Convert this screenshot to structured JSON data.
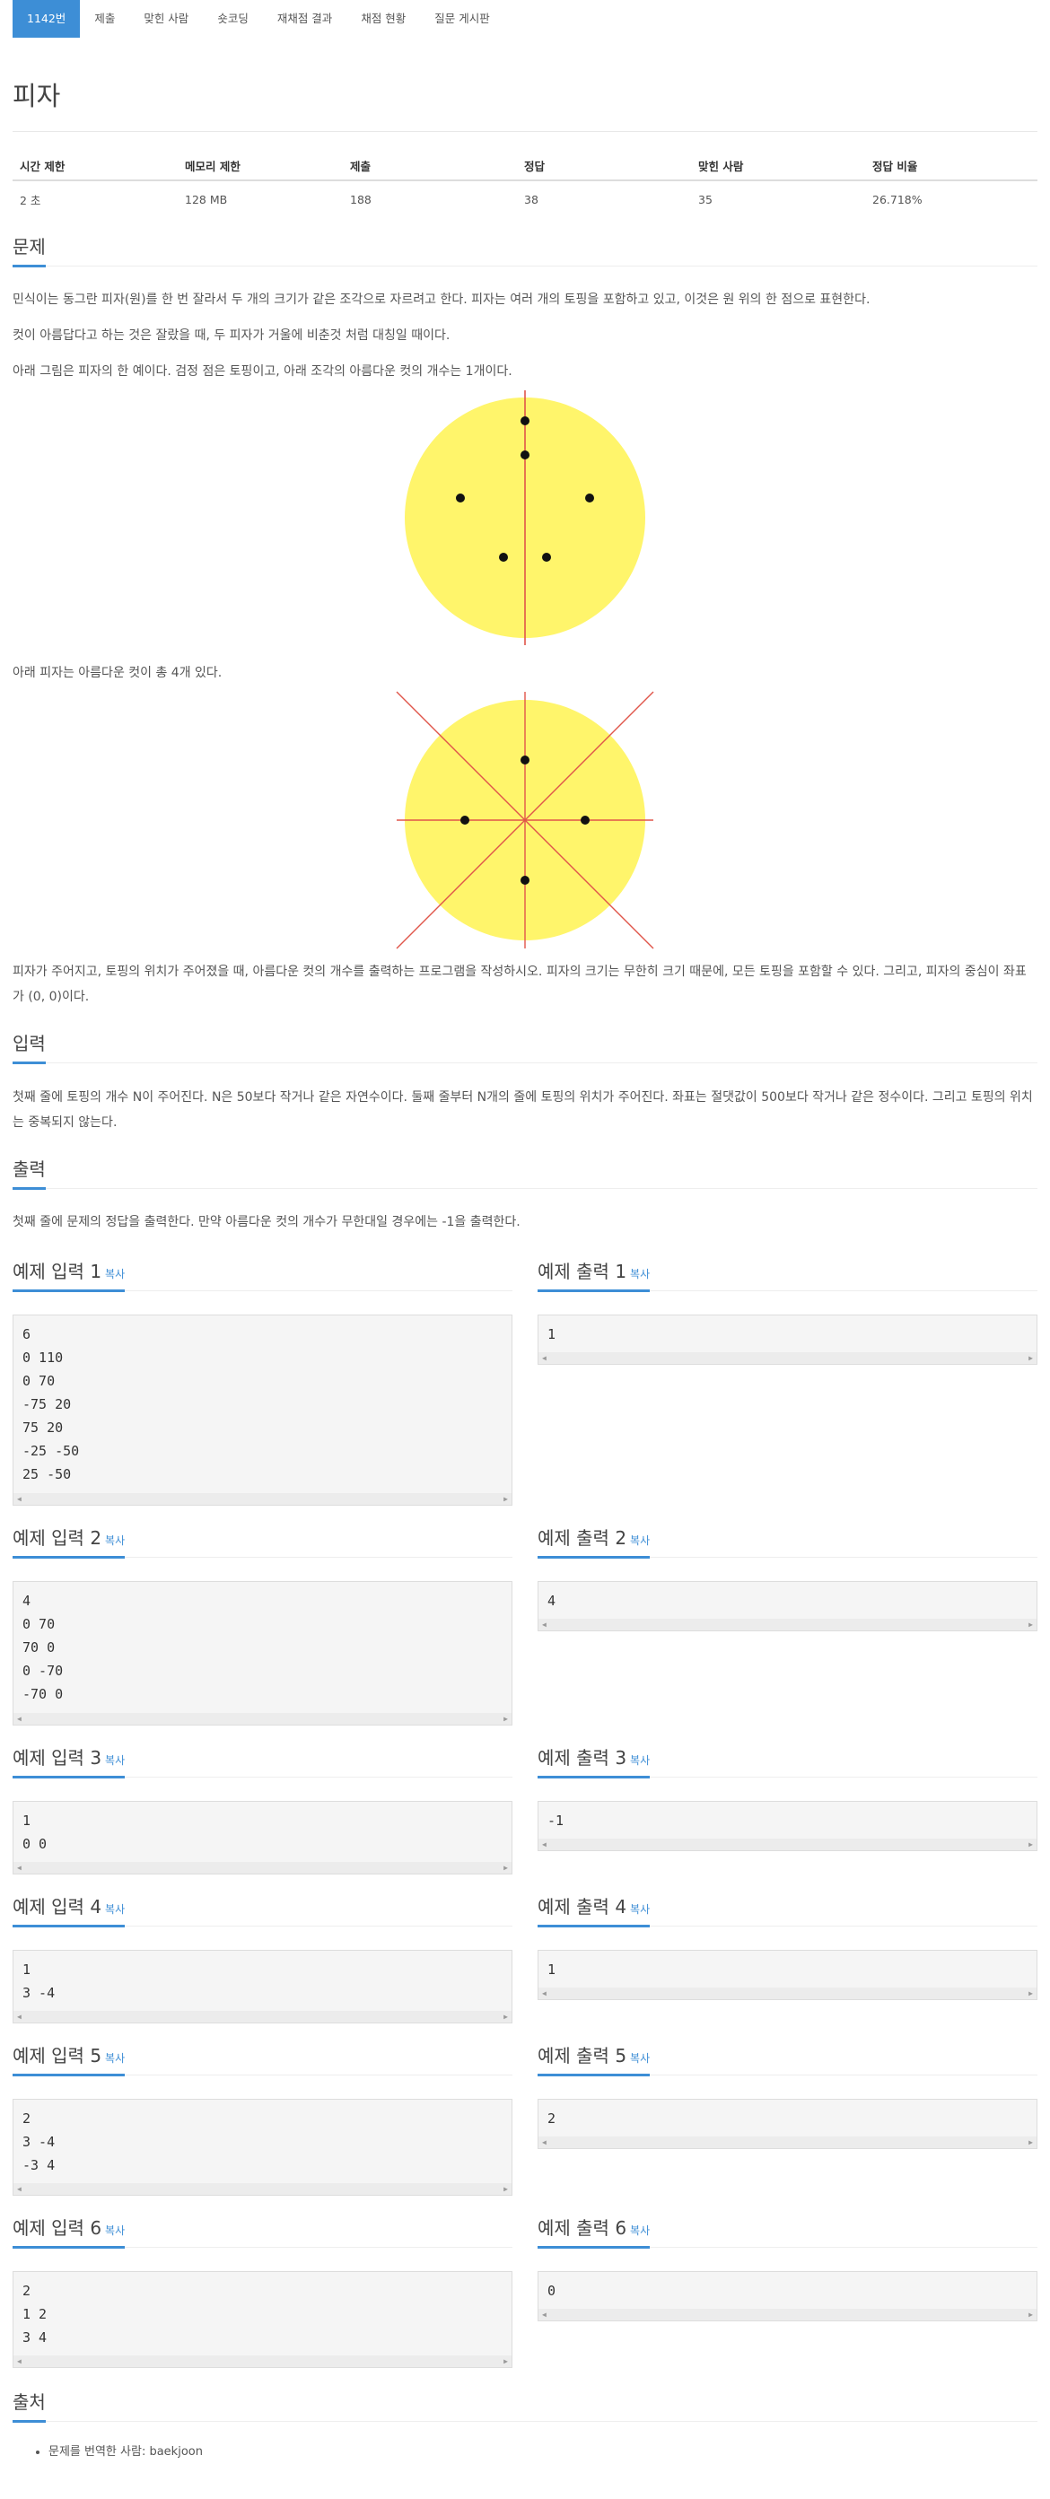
{
  "tabs": [
    "1142번",
    "제출",
    "맞힌 사람",
    "숏코딩",
    "재채점 결과",
    "채점 현황",
    "질문 게시판"
  ],
  "title": "피자",
  "stats": {
    "headers": [
      "시간 제한",
      "메모리 제한",
      "제출",
      "정답",
      "맞힌 사람",
      "정답 비율"
    ],
    "values": [
      "2 초",
      "128 MB",
      "188",
      "38",
      "35",
      "26.718%"
    ]
  },
  "problem": {
    "heading": "문제",
    "p1": "민식이는 동그란 피자(원)를 한 번 잘라서 두 개의 크기가 같은 조각으로 자르려고 한다. 피자는 여러 개의 토핑을 포함하고 있고, 이것은 원 위의 한 점으로 표현한다.",
    "p2": "컷이 아름답다고 하는 것은 잘랐을 때, 두 피자가 거울에 비춘것 처럼 대칭일 때이다.",
    "p3": "아래 그림은 피자의 한 예이다. 검정 점은 토핑이고, 아래 조각의 아름다운 컷의 개수는 1개이다.",
    "p4": "아래 피자는 아름다운 컷이 총 4개 있다.",
    "p5": "피자가 주어지고, 토핑의 위치가 주어졌을 때, 아름다운 컷의 개수를 출력하는 프로그램을 작성하시오. 피자의 크기는 무한히 크기 때문에, 모든 토핑을 포함할 수 있다. 그리고, 피자의 중심이 좌표가 (0, 0)이다."
  },
  "input": {
    "heading": "입력",
    "text": "첫째 줄에 토핑의 개수 N이 주어진다. N은 50보다 작거나 같은 자연수이다. 둘째 줄부터 N개의 줄에 토핑의 위치가 주어진다. 좌표는 절댓값이 500보다 작거나 같은 정수이다. 그리고 토핑의 위치는 중복되지 않는다."
  },
  "output": {
    "heading": "출력",
    "text": "첫째 줄에 문제의 정답을 출력한다. 만약 아름다운 컷의 개수가 무한대일 경우에는 -1을 출력한다."
  },
  "copy_label": "복사",
  "samples": [
    {
      "in_title": "예제 입력 1",
      "in": "6\n0 110\n0 70\n-75 20\n75 20\n-25 -50\n25 -50",
      "out_title": "예제 출력 1",
      "out": "1"
    },
    {
      "in_title": "예제 입력 2",
      "in": "4\n0 70\n70 0\n0 -70\n-70 0",
      "out_title": "예제 출력 2",
      "out": "4"
    },
    {
      "in_title": "예제 입력 3",
      "in": "1\n0 0",
      "out_title": "예제 출력 3",
      "out": "-1"
    },
    {
      "in_title": "예제 입력 4",
      "in": "1\n3 -4",
      "out_title": "예제 출력 4",
      "out": "1"
    },
    {
      "in_title": "예제 입력 5",
      "in": "2\n3 -4\n-3 4",
      "out_title": "예제 출력 5",
      "out": "2"
    },
    {
      "in_title": "예제 입력 6",
      "in": "2\n1 2\n3 4",
      "out_title": "예제 출력 6",
      "out": "0"
    }
  ],
  "source": {
    "heading": "출처",
    "item": "문제를 번역한 사람: baekjoon"
  },
  "colors": {
    "accent": "#3d8ed6",
    "pizza": "#fff56b",
    "cut": "#e0554a",
    "topping": "#111111"
  }
}
